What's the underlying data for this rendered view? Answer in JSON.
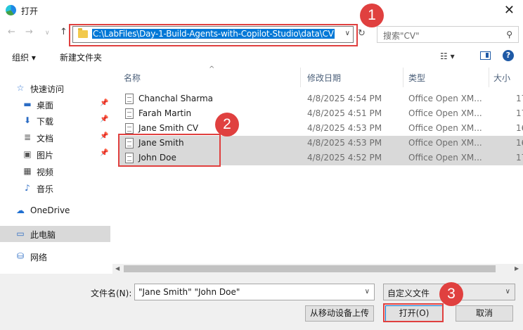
{
  "window": {
    "title": "打开",
    "close_icon": "close-icon"
  },
  "nav": {
    "address": "C:\\LabFiles\\Day-1-Build-Agents-with-Copilot-Studio\\data\\CV",
    "search_placeholder": "搜索\"CV\""
  },
  "toolbar": {
    "organize": "组织 ▾",
    "new_folder": "新建文件夹"
  },
  "sidebar": {
    "items": [
      {
        "label": "快速访问",
        "icon": "☆"
      },
      {
        "label": "桌面",
        "icon": "▬"
      },
      {
        "label": "下载",
        "icon": "⬇"
      },
      {
        "label": "文档",
        "icon": "≣"
      },
      {
        "label": "图片",
        "icon": "▣"
      },
      {
        "label": "视频",
        "icon": "▦"
      },
      {
        "label": "音乐",
        "icon": "♪"
      },
      {
        "label": "OneDrive",
        "icon": "☁"
      },
      {
        "label": "此电脑",
        "icon": "▭"
      },
      {
        "label": "网络",
        "icon": "⛁"
      }
    ]
  },
  "columns": {
    "name": "名称",
    "modified": "修改日期",
    "type": "类型",
    "size": "大小"
  },
  "files": [
    {
      "name": "Chanchal Sharma",
      "modified": "4/8/2025 4:54 PM",
      "type": "Office Open XM...",
      "size": "17"
    },
    {
      "name": "Farah Martin",
      "modified": "4/8/2025 4:51 PM",
      "type": "Office Open XM...",
      "size": "17"
    },
    {
      "name": "Jane Smith CV",
      "modified": "4/8/2025 4:53 PM",
      "type": "Office Open XM...",
      "size": "16"
    },
    {
      "name": "Jane Smith",
      "modified": "4/8/2025 4:53 PM",
      "type": "Office Open XM...",
      "size": "16"
    },
    {
      "name": "John Doe",
      "modified": "4/8/2025 4:52 PM",
      "type": "Office Open XM...",
      "size": "17"
    }
  ],
  "bottom": {
    "filename_label": "文件名(N):",
    "filename_value": "\"Jane Smith\" \"John Doe\"",
    "filter_value": "自定义文件",
    "upload_button": "从移动设备上传",
    "open_button": "打开(O)",
    "cancel_button": "取消"
  },
  "callouts": [
    "1",
    "2",
    "3"
  ],
  "colors": {
    "callout": "#e0403f",
    "selection": "#0078d7"
  }
}
